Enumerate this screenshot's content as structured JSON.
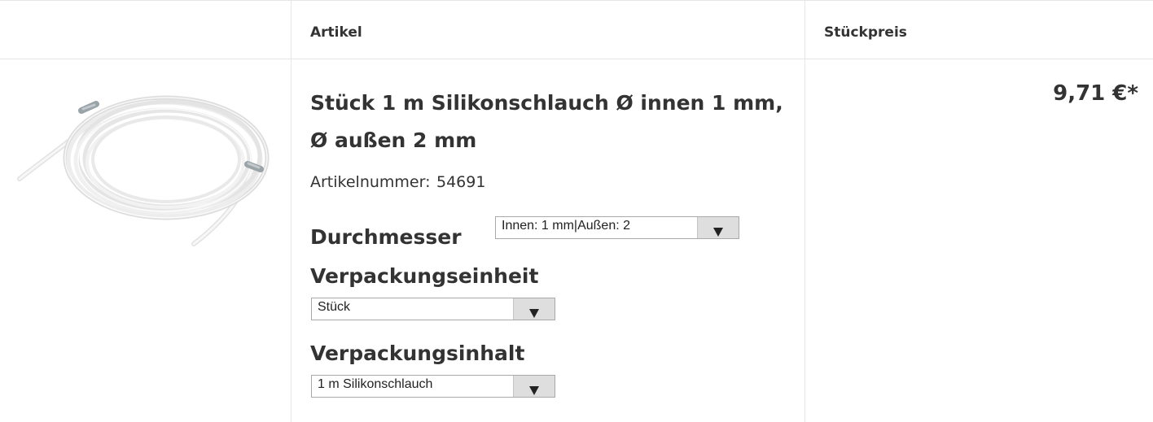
{
  "table": {
    "headers": {
      "image": "",
      "article": "Artikel",
      "unit_price": "Stückpreis"
    }
  },
  "product": {
    "image_alt": "Silikonschlauch",
    "title": "Stück 1 m Silikonschlauch Ø innen 1 mm, Ø außen 2 mm",
    "article_number_label": "Artikelnummer:",
    "article_number": "54691",
    "price": "9,71 €*",
    "options": [
      {
        "label": "Durchmesser",
        "selected": "Innen: 1 mm|Außen: 2"
      },
      {
        "label": "Verpackungseinheit",
        "selected": "Stück"
      },
      {
        "label": "Verpackungsinhalt",
        "selected": "1 m Silikonschlauch"
      }
    ]
  },
  "colors": {
    "text": "#333333",
    "border": "#e6e6e6",
    "select_button": "#dedede"
  },
  "icons": {
    "dropdown": "triangle-down-icon"
  }
}
